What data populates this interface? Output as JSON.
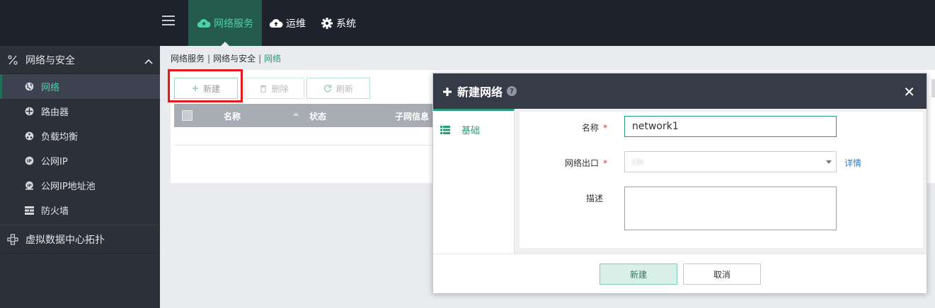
{
  "topnav": {
    "items": [
      {
        "label": "网络服务",
        "icon": "cloud-icon",
        "active": true
      },
      {
        "label": "运维",
        "icon": "cloud-upload-icon"
      },
      {
        "label": "系统",
        "icon": "gear-icon"
      }
    ],
    "colors": {
      "bg": "#1e222d",
      "active_bg": "#235a4c",
      "active_text": "#4fd1a5"
    }
  },
  "sidebar": {
    "group1": {
      "label": "网络与安全",
      "icon": "percent-icon"
    },
    "items": [
      {
        "label": "网络",
        "icon": "globe-icon",
        "active": true
      },
      {
        "label": "路由器",
        "icon": "router-icon"
      },
      {
        "label": "负载均衡",
        "icon": "balance-icon"
      },
      {
        "label": "公网IP",
        "icon": "ip-icon"
      },
      {
        "label": "公网IP地址池",
        "icon": "ip-pool-icon"
      },
      {
        "label": "防火墙",
        "icon": "firewall-icon"
      }
    ],
    "group2": {
      "label": "虚拟数据中心拓扑",
      "icon": "topology-icon"
    }
  },
  "breadcrumb": {
    "items": [
      "网络服务",
      "网络与安全"
    ],
    "current": "网络",
    "separator": "|"
  },
  "toolbar": {
    "new_label": "新建",
    "delete_label": "删除",
    "refresh_label": "刷新"
  },
  "table": {
    "columns": [
      "名称",
      "状态",
      "子网信息"
    ]
  },
  "modal": {
    "title": "新建网络",
    "help": "?",
    "close": "✕",
    "tab_label": "基础",
    "form": {
      "name_label": "名称",
      "name_value": "network1",
      "required_mark": "*",
      "outlet_label": "网络出口",
      "outlet_value": "cls",
      "detail_link": "详情",
      "desc_label": "描述"
    },
    "confirm_label": "新建",
    "cancel_label": "取消"
  }
}
